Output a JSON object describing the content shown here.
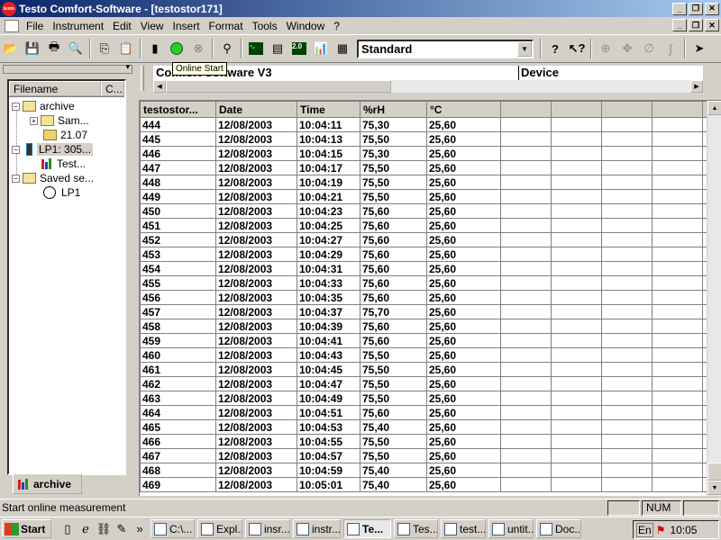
{
  "window": {
    "title": "Testo Comfort-Software - [testostor171]",
    "logo_text": "testo"
  },
  "window_buttons": {
    "minimize": "_",
    "restore": "❐",
    "close": "✕"
  },
  "menu": [
    "File",
    "Instrument",
    "Edit",
    "View",
    "Insert",
    "Format",
    "Tools",
    "Window",
    "?"
  ],
  "toolbar": {
    "style_value": "Standard",
    "tooltip": "Online Start"
  },
  "tree": {
    "headers": [
      "Filename",
      "C..."
    ],
    "items": [
      {
        "label": "archive",
        "icon": "folder-icon"
      },
      {
        "label": "Sam...",
        "icon": "folder-icon"
      },
      {
        "label": "21.07",
        "icon": "data-file-icon"
      },
      {
        "label": "LP1: 305...",
        "icon": "instrument-icon"
      },
      {
        "label": "Test...",
        "icon": "chart-icon"
      },
      {
        "label": "Saved se...",
        "icon": "folder-icon"
      },
      {
        "label": "LP1",
        "icon": "clock-icon"
      }
    ],
    "tab_label": "archive"
  },
  "info": {
    "software": "Comfort Software V3",
    "device": "Device"
  },
  "grid": {
    "headers": [
      "testostor...",
      "Date",
      "Time",
      "%rH",
      "°C"
    ],
    "rows": [
      [
        "444",
        "12/08/2003",
        "10:04:11",
        "75,30",
        "25,60"
      ],
      [
        "445",
        "12/08/2003",
        "10:04:13",
        "75,50",
        "25,60"
      ],
      [
        "446",
        "12/08/2003",
        "10:04:15",
        "75,30",
        "25,60"
      ],
      [
        "447",
        "12/08/2003",
        "10:04:17",
        "75,50",
        "25,60"
      ],
      [
        "448",
        "12/08/2003",
        "10:04:19",
        "75,50",
        "25,60"
      ],
      [
        "449",
        "12/08/2003",
        "10:04:21",
        "75,50",
        "25,60"
      ],
      [
        "450",
        "12/08/2003",
        "10:04:23",
        "75,60",
        "25,60"
      ],
      [
        "451",
        "12/08/2003",
        "10:04:25",
        "75,60",
        "25,60"
      ],
      [
        "452",
        "12/08/2003",
        "10:04:27",
        "75,60",
        "25,60"
      ],
      [
        "453",
        "12/08/2003",
        "10:04:29",
        "75,60",
        "25,60"
      ],
      [
        "454",
        "12/08/2003",
        "10:04:31",
        "75,60",
        "25,60"
      ],
      [
        "455",
        "12/08/2003",
        "10:04:33",
        "75,60",
        "25,60"
      ],
      [
        "456",
        "12/08/2003",
        "10:04:35",
        "75,60",
        "25,60"
      ],
      [
        "457",
        "12/08/2003",
        "10:04:37",
        "75,70",
        "25,60"
      ],
      [
        "458",
        "12/08/2003",
        "10:04:39",
        "75,60",
        "25,60"
      ],
      [
        "459",
        "12/08/2003",
        "10:04:41",
        "75,60",
        "25,60"
      ],
      [
        "460",
        "12/08/2003",
        "10:04:43",
        "75,50",
        "25,60"
      ],
      [
        "461",
        "12/08/2003",
        "10:04:45",
        "75,50",
        "25,60"
      ],
      [
        "462",
        "12/08/2003",
        "10:04:47",
        "75,50",
        "25,60"
      ],
      [
        "463",
        "12/08/2003",
        "10:04:49",
        "75,50",
        "25,60"
      ],
      [
        "464",
        "12/08/2003",
        "10:04:51",
        "75,60",
        "25,60"
      ],
      [
        "465",
        "12/08/2003",
        "10:04:53",
        "75,40",
        "25,60"
      ],
      [
        "466",
        "12/08/2003",
        "10:04:55",
        "75,50",
        "25,60"
      ],
      [
        "467",
        "12/08/2003",
        "10:04:57",
        "75,50",
        "25,60"
      ],
      [
        "468",
        "12/08/2003",
        "10:04:59",
        "75,40",
        "25,60"
      ],
      [
        "469",
        "12/08/2003",
        "10:05:01",
        "75,40",
        "25,60"
      ]
    ]
  },
  "status": {
    "text": "Start online measurement",
    "num": "NUM"
  },
  "taskbar": {
    "start": "Start",
    "buttons": [
      "C:\\...",
      "Expl...",
      "insr...",
      "instr...",
      "Te...",
      "Tes...",
      "test...",
      "untit...",
      "Doc..."
    ],
    "active_index": 4,
    "lang": "En",
    "clock": "10:05"
  }
}
